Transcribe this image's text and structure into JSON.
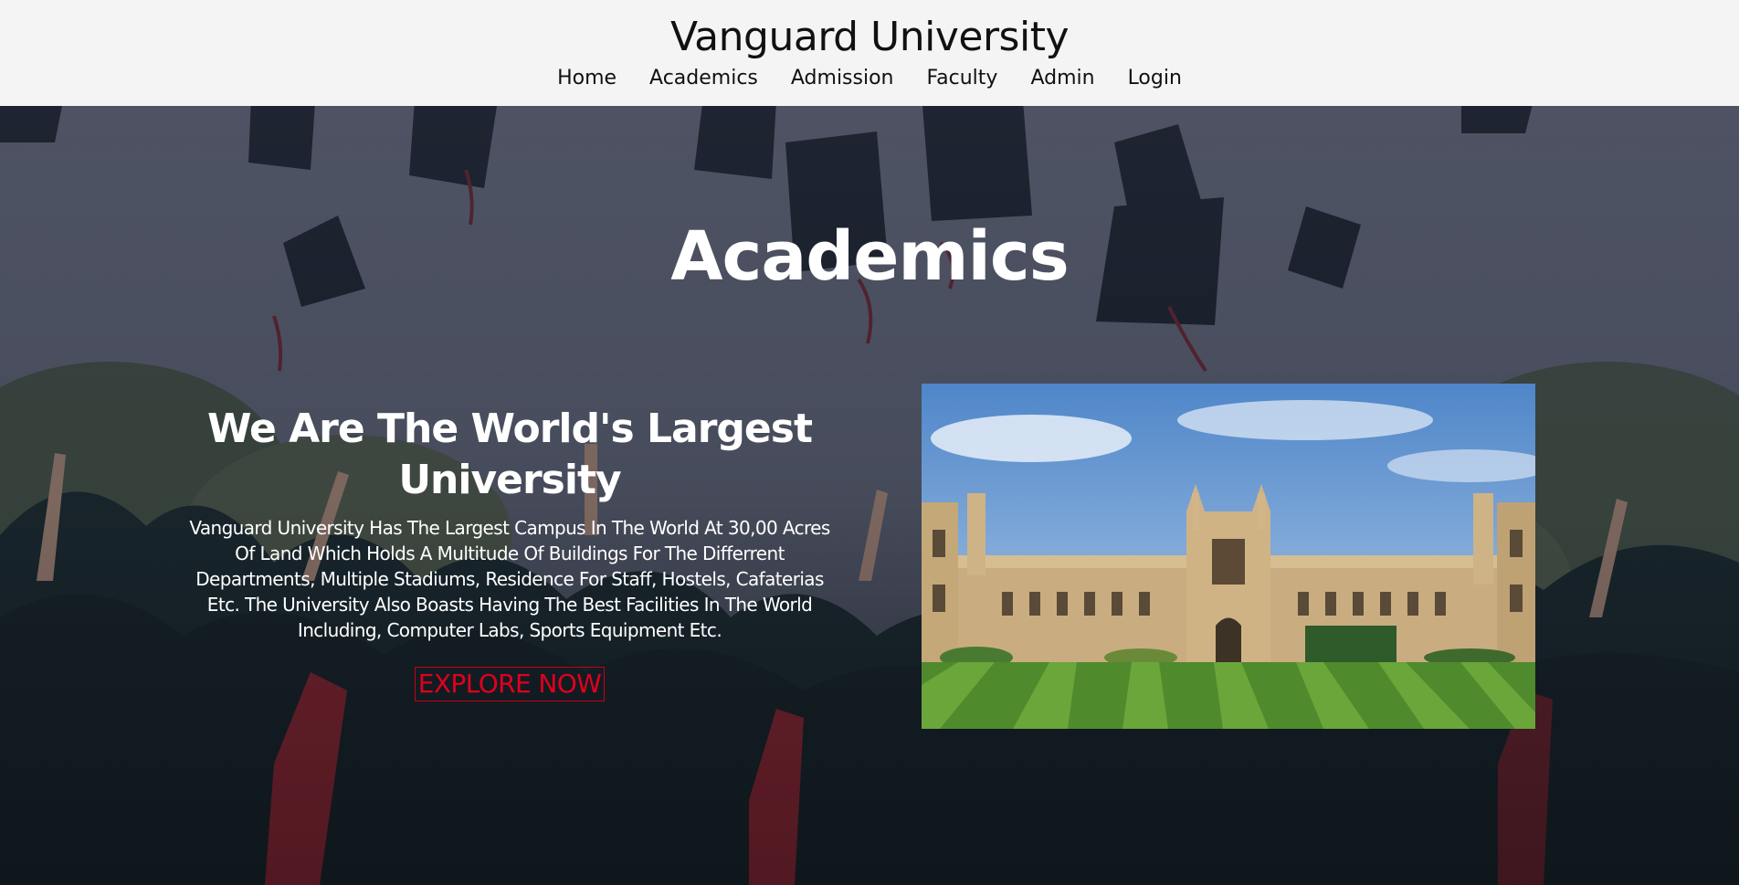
{
  "header": {
    "title": "Vanguard University",
    "nav": [
      "Home",
      "Academics",
      "Admission",
      "Faculty",
      "Admin",
      "Login"
    ]
  },
  "hero": {
    "heading": "Academics",
    "intro": {
      "headline": "We Are The World's Largest University",
      "body": "Vanguard University Has The Largest Campus In The World At 30,00 Acres Of Land Which Holds A Multitude Of Buildings For The Differrent Departments, Multiple Stadiums, Residence For Staff, Hostels, Cafaterias Etc. The University Also Boasts Having The Best Facilities In The World Including, Computer Labs, Sports Equipment Etc.",
      "button": "EXPLORE NOW"
    }
  },
  "colors": {
    "header_bg": "#f4f4f4",
    "button_accent": "#e0001e",
    "heading_text": "#ffffff"
  }
}
